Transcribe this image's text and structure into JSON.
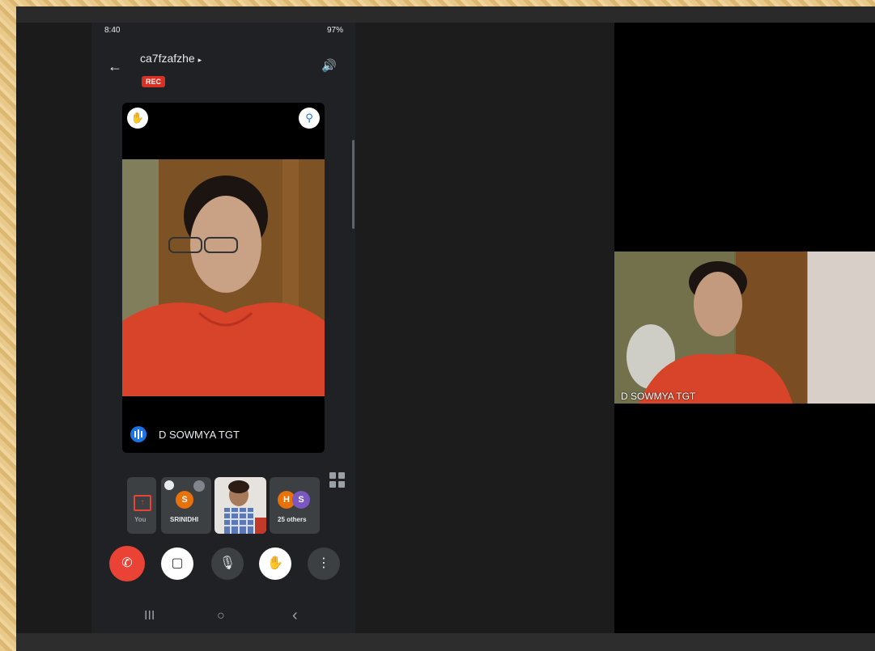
{
  "phone": {
    "status_time": "8:40",
    "status_right": "97%",
    "meeting_code": "ca7fzafzhe",
    "rec_badge": "REC",
    "speaker_name": "D SOWMYA TGT",
    "participants": {
      "present_label": "You",
      "srinidhi_initial": "S",
      "srinidhi_label": "SRINIDHI",
      "others_initials": [
        "H",
        "S"
      ],
      "others_label": "25 others"
    },
    "nav": {
      "recents": "III",
      "home": "○",
      "back": "‹"
    }
  },
  "desktop": {
    "tile_name": "D SOWMYA TGT"
  },
  "colors": {
    "rec": "#d93025",
    "end_call": "#ea4335",
    "voice": "#1a73e8"
  }
}
